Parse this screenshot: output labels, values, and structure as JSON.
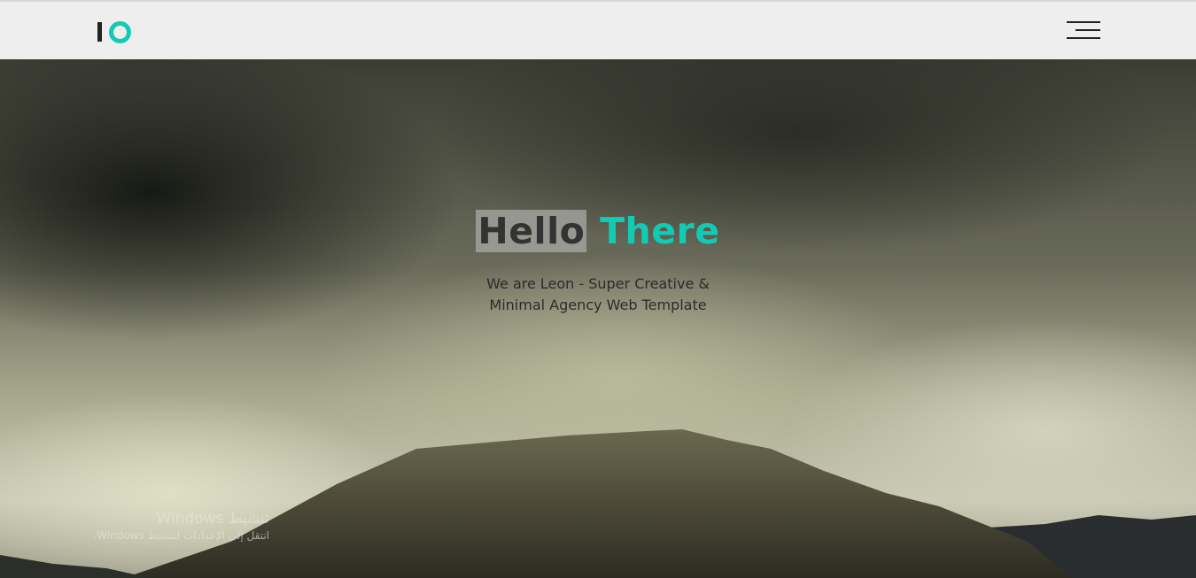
{
  "header": {
    "logo_text": "IO",
    "accent_color": "#12cbb5",
    "menu_icon": "hamburger-icon"
  },
  "hero": {
    "title_word1": "Hello",
    "title_word2": "There",
    "subtitle_line1": "We are Leon - Super Creative &",
    "subtitle_line2": "Minimal Agency Web Template"
  },
  "watermark": {
    "line1": "تنشيط Windows",
    "line2": "انتقل إلى الإعدادات لتنشيط Windows."
  }
}
